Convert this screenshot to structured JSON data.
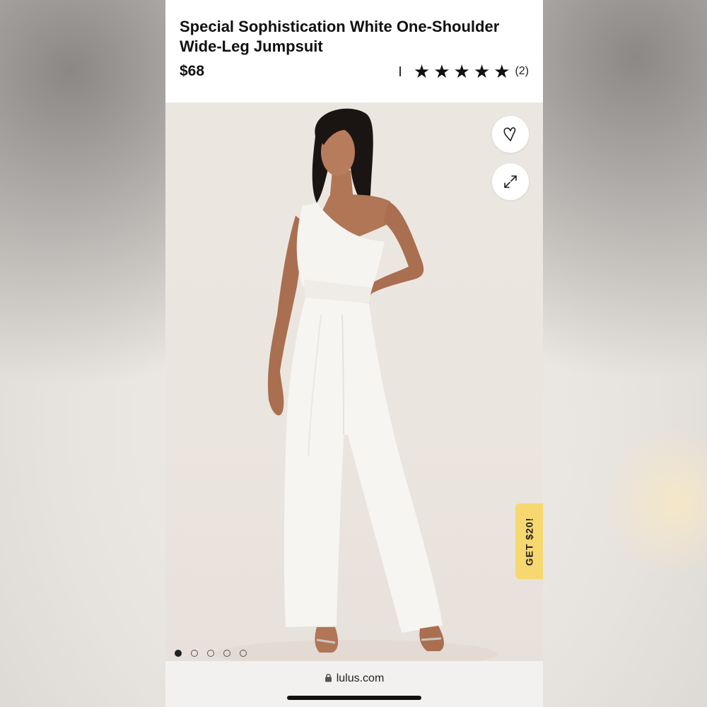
{
  "product": {
    "title": "Special Sophistication White One-Shoulder Wide-Leg Jumpsuit",
    "price": "$68",
    "rating_stars": 5,
    "review_count": "(2)"
  },
  "gallery": {
    "image_count": 5,
    "active_index": 0,
    "background_color": "#ebe5df",
    "wishlist_icon": "heart-icon",
    "expand_icon": "expand-arrows-icon"
  },
  "promo": {
    "label": "GET $20!",
    "color": "#f7d870"
  },
  "browser": {
    "url": "lulus.com",
    "lock_icon": "lock-icon"
  }
}
